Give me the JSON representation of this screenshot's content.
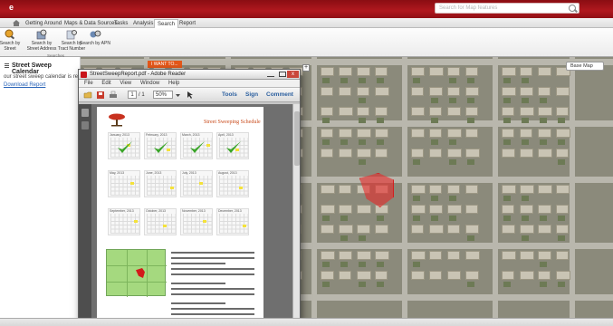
{
  "app": {
    "logo_text": "e",
    "search_placeholder": "Search for Map features"
  },
  "ribbon": {
    "tabs": [
      {
        "label": "Getting Around"
      },
      {
        "label": "Maps & Data Sources"
      },
      {
        "label": "Tasks"
      },
      {
        "label": "Analysis"
      },
      {
        "label": "Search"
      },
      {
        "label": "Report"
      }
    ],
    "active_tab": "Search",
    "buttons": [
      {
        "label": "Search by Street",
        "icon": "magnifier-icon"
      },
      {
        "label": "Search by Street Address",
        "icon": "address-search-icon"
      },
      {
        "label": "Search by Tract Number",
        "icon": "tract-search-icon"
      },
      {
        "label": "Search by APN",
        "icon": "apn-search-icon"
      }
    ],
    "group_label": "Searches"
  },
  "panel": {
    "title": "Street Sweep Calendar",
    "text": "our street sweep calendar is read",
    "link": "Download Report"
  },
  "map": {
    "tool_badge": "I WANT TO...",
    "basemap_button": "Base Map",
    "zoom_plus": "+",
    "highlight_color": "#e62b2b"
  },
  "reader": {
    "title": "StreetSweepReport.pdf - Adobe Reader",
    "menu": [
      "File",
      "Edit",
      "View",
      "Window",
      "Help"
    ],
    "page_current": "1",
    "page_total": "/ 1",
    "zoom": "50%",
    "tools": "Tools",
    "sign": "Sign",
    "comment": "Comment",
    "close_glyph": "x"
  },
  "document": {
    "title": "Street Sweeping Schedule",
    "months": [
      "January, 2013",
      "February, 2013",
      "March, 2013",
      "April, 2013",
      "May, 2013",
      "June, 2013",
      "July, 2013",
      "August, 2013",
      "September, 2013",
      "October, 2013",
      "November, 2013",
      "December, 2013"
    ],
    "checked_months": 4
  }
}
